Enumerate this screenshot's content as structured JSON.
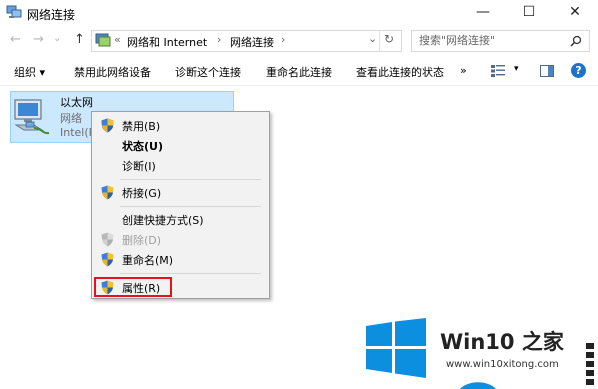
{
  "window": {
    "title": "网络连接",
    "minimize_glyph": "—",
    "maximize_glyph": "☐",
    "close_glyph": "✕"
  },
  "address_bar": {
    "back_glyph": "←",
    "forward_glyph": "→",
    "recent_glyph": "⌄",
    "up_glyph": "↑",
    "prefix_glyph": "«",
    "crumbs": [
      "网络和 Internet",
      "网络连接"
    ],
    "separator_glyph": "›",
    "dropdown_glyph": "⌄",
    "refresh_glyph": "↻"
  },
  "search": {
    "placeholder": "搜索\"网络连接\""
  },
  "command_bar": {
    "organize": "组织 ▾",
    "disable": "禁用此网络设备",
    "diagnose": "诊断这个连接",
    "rename": "重命名此连接",
    "view_status": "查看此连接的状态",
    "more": "»",
    "view_menu_arrow": "▾",
    "help_glyph": "?"
  },
  "adapter": {
    "name": "以太网",
    "network": "网络",
    "device": "Intel(R"
  },
  "context_menu": {
    "disable": "禁用(B)",
    "status": "状态(U)",
    "diagnose": "诊断(I)",
    "bridge": "桥接(G)",
    "shortcut": "创建快捷方式(S)",
    "delete": "删除(D)",
    "rename": "重命名(M)",
    "properties": "属性(R)"
  },
  "watermark": {
    "brand": "Win10 之家",
    "url": "www.win10xitong.com"
  },
  "colors": {
    "selection_fill": "#cce8ff",
    "selection_border": "#99d1ff",
    "highlight_border": "#e81123",
    "help_blue": "#1d73c9",
    "windows_logo_blue": "#0d8fe0"
  },
  "icons": {
    "app": "network-connections-icon",
    "adapter": "ethernet-adapter-icon",
    "shield": "uac-shield-icon",
    "search": "search-icon",
    "help": "help-icon"
  }
}
